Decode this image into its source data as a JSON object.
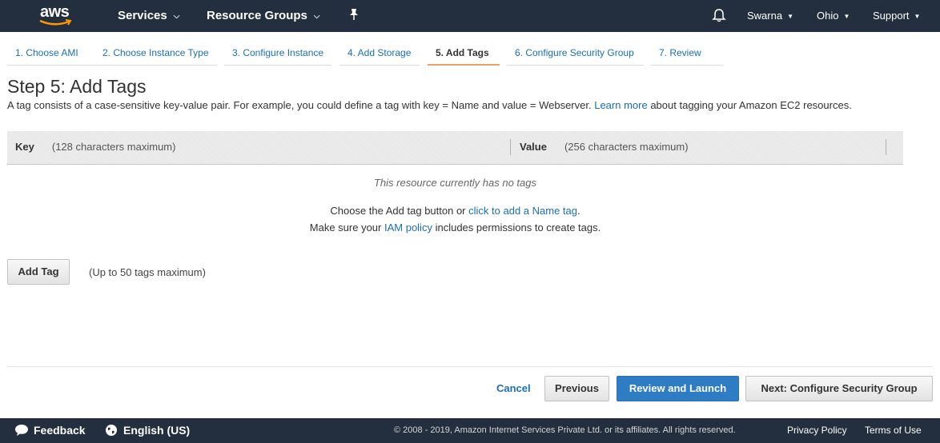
{
  "nav": {
    "logo_text": "aws",
    "services": "Services",
    "resource_groups": "Resource Groups",
    "pin_icon": "pin-icon",
    "bell_icon": "bell-icon",
    "user": "Swarna",
    "region": "Ohio",
    "support": "Support"
  },
  "wizard": {
    "tabs": [
      {
        "label": "1. Choose AMI"
      },
      {
        "label": "2. Choose Instance Type"
      },
      {
        "label": "3. Configure Instance"
      },
      {
        "label": "4. Add Storage"
      },
      {
        "label": "5. Add Tags",
        "active": true
      },
      {
        "label": "6. Configure Security Group"
      },
      {
        "label": "7. Review"
      }
    ]
  },
  "page": {
    "title": "Step 5: Add Tags",
    "intro_before": "A tag consists of a case-sensitive key-value pair. For example, you could define a tag with key = Name and value = Webserver.",
    "intro_link": "Learn more",
    "intro_after": "about tagging your Amazon EC2 resources."
  },
  "table": {
    "key_header": "Key",
    "key_hint": "(128 characters maximum)",
    "value_header": "Value",
    "value_hint": "(256 characters maximum)",
    "empty_text": "This resource currently has no tags"
  },
  "help": {
    "line1_before": "Choose the Add tag button or",
    "line1_link": "click to add a Name tag",
    "line1_after": ".",
    "line2_before": "Make sure your",
    "line2_link": "IAM policy",
    "line2_after": "includes permissions to create tags."
  },
  "actions": {
    "add_tag": "Add Tag",
    "add_tag_hint": "(Up to 50 tags maximum)",
    "cancel": "Cancel",
    "previous": "Previous",
    "review_launch": "Review and Launch",
    "next": "Next: Configure Security Group"
  },
  "footer": {
    "feedback": "Feedback",
    "language": "English (US)",
    "copyright": "© 2008 - 2019, Amazon Internet Services Private Ltd. or its affiliates. All rights reserved.",
    "privacy": "Privacy Policy",
    "terms": "Terms of Use"
  },
  "colors": {
    "nav_bg": "#232f3e",
    "link": "#1b6fb5",
    "primary": "#2e7cc4",
    "active_tab_underline": "#e7a264"
  }
}
